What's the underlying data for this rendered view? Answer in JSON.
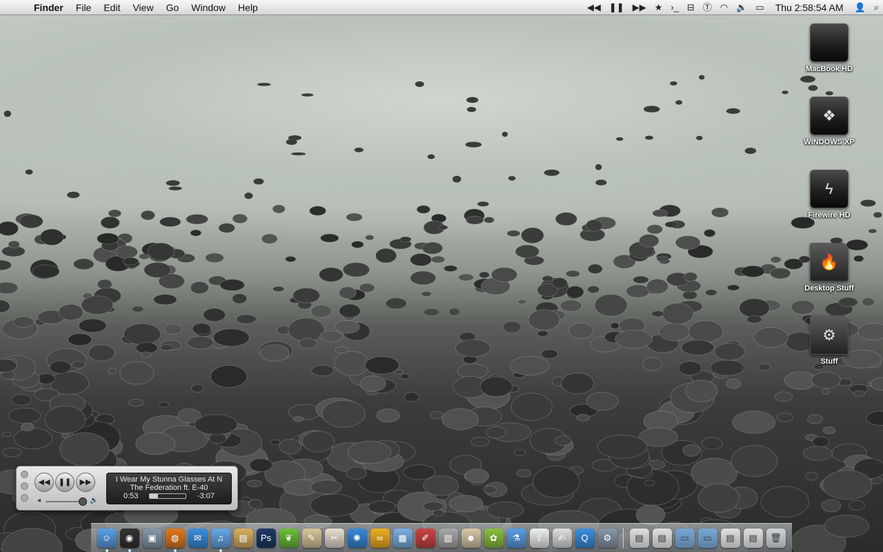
{
  "menubar": {
    "app_name": "Finder",
    "menus": [
      "File",
      "Edit",
      "View",
      "Go",
      "Window",
      "Help"
    ],
    "clock": "Thu 2:58:54 AM",
    "extras": [
      "rewind-icon",
      "pause-icon",
      "fast-forward-icon",
      "star-icon",
      "terminal-icon",
      "minus-icon",
      "typinator-icon",
      "wifi-icon",
      "volume-icon",
      "battery-icon",
      "user-icon",
      "spotlight-icon"
    ]
  },
  "desktop_icons": [
    {
      "label": "MacBook HD",
      "icon": "hard-drive-icon"
    },
    {
      "label": "WINDOWS XP",
      "icon": "hard-drive-icon"
    },
    {
      "label": "Firewire HD",
      "icon": "firewire-drive-icon"
    },
    {
      "label": "Desktop Stuff",
      "icon": "folder-icon"
    },
    {
      "label": "Stuff",
      "icon": "folder-icon"
    }
  ],
  "player": {
    "track": "I Wear My Stunna Glasses At N",
    "artist": "The Federation ft. E-40",
    "elapsed": "0:53",
    "remaining": "-3:07",
    "progress": 0.22,
    "volume": 0.85
  },
  "dock": {
    "colors": {
      "finder": "#5aa0e6",
      "dashboard": "#333333",
      "preview": "#8899aa",
      "firefox": "#e07a1f",
      "ichat": "#3a8fe0",
      "itunes": "#66a8e8",
      "archive": "#d9b060",
      "photoshop": "#1f3a66",
      "leaf": "#6bbf3a",
      "feather": "#d8c89a",
      "css": "#e8e0d0",
      "safari": "#3a88d8",
      "ring": "#f0b020",
      "cube": "#7ab0e0",
      "pen": "#cc4444",
      "calc": "#aaaaaa",
      "photo": "#d8c8a8",
      "green": "#8dc040",
      "flickr": "#f0f0f0",
      "doc": "#e0e0e0",
      "folder": "#7aa8d8",
      "trash": "#cfd4d8"
    }
  }
}
